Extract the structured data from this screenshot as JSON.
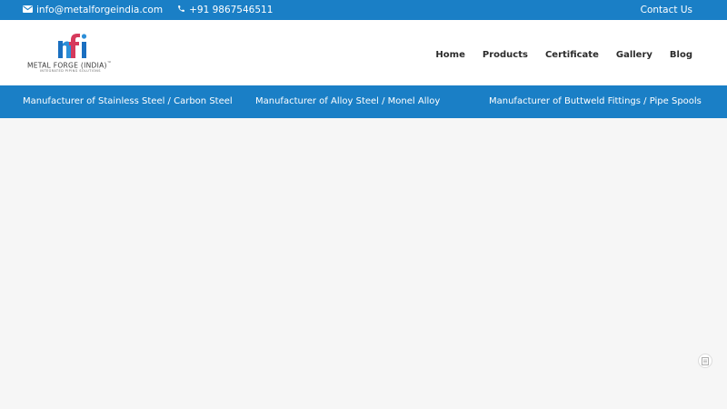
{
  "topbar": {
    "email_icon": "envelope-icon",
    "email": "info@metalforgeindia.com",
    "phone_icon": "phone-icon",
    "phone": "+91 9867546511",
    "contact_us": "Contact Us"
  },
  "logo": {
    "name": "METAL FORGE (INDIA)",
    "trademark": "™",
    "tagline": "INTEGRATED PIPING SOLUTIONS"
  },
  "nav": {
    "items": [
      "Home",
      "Products",
      "Certificate",
      "Gallery",
      "Blog"
    ]
  },
  "strip": {
    "items": [
      "Manufacturer of Stainless Steel / Carbon Steel",
      "Manufacturer of Alloy Steel / Monel Alloy",
      "Manufacturer of Buttweld Fittings / Pipe Spools"
    ]
  },
  "floating_button": {
    "icon": "document-icon"
  },
  "colors": {
    "brand_blue": "#1a7fc6",
    "header_bg": "#ffffff",
    "content_bg": "#f6f6f6"
  }
}
